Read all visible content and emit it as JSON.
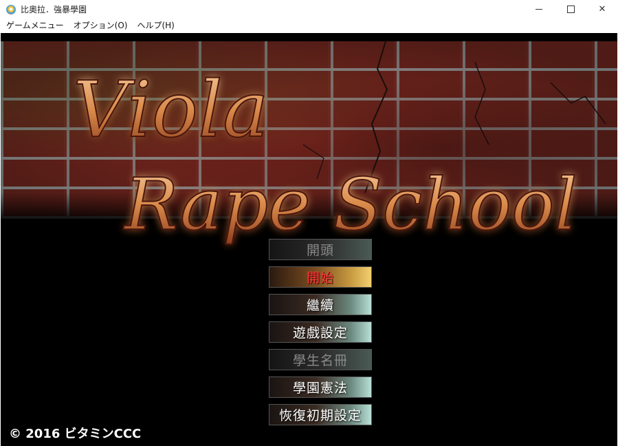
{
  "window": {
    "title": "比奧拉．強暴學園",
    "icon": "app-icon",
    "controls": {
      "minimize_icon": "minimize-icon",
      "maximize_icon": "maximize-icon",
      "close_glyph": "✕"
    }
  },
  "menubar": {
    "items": [
      {
        "label": "ゲームメニュー"
      },
      {
        "label": "オプション(O)"
      },
      {
        "label": "ヘルプ(H)"
      }
    ]
  },
  "game": {
    "logo": {
      "line1": "Viola",
      "line2": "Rape School",
      "color": "#d98a4a"
    },
    "menu": [
      {
        "label": "開頭",
        "state": "disabled"
      },
      {
        "label": "開始",
        "state": "active"
      },
      {
        "label": "繼續",
        "state": "normal"
      },
      {
        "label": "遊戲設定",
        "state": "normal"
      },
      {
        "label": "學生名冊",
        "state": "disabled"
      },
      {
        "label": "學園憲法",
        "state": "normal"
      },
      {
        "label": "恢復初期設定",
        "state": "normal"
      }
    ],
    "copyright": "© 2016 ビタミンCCC"
  }
}
